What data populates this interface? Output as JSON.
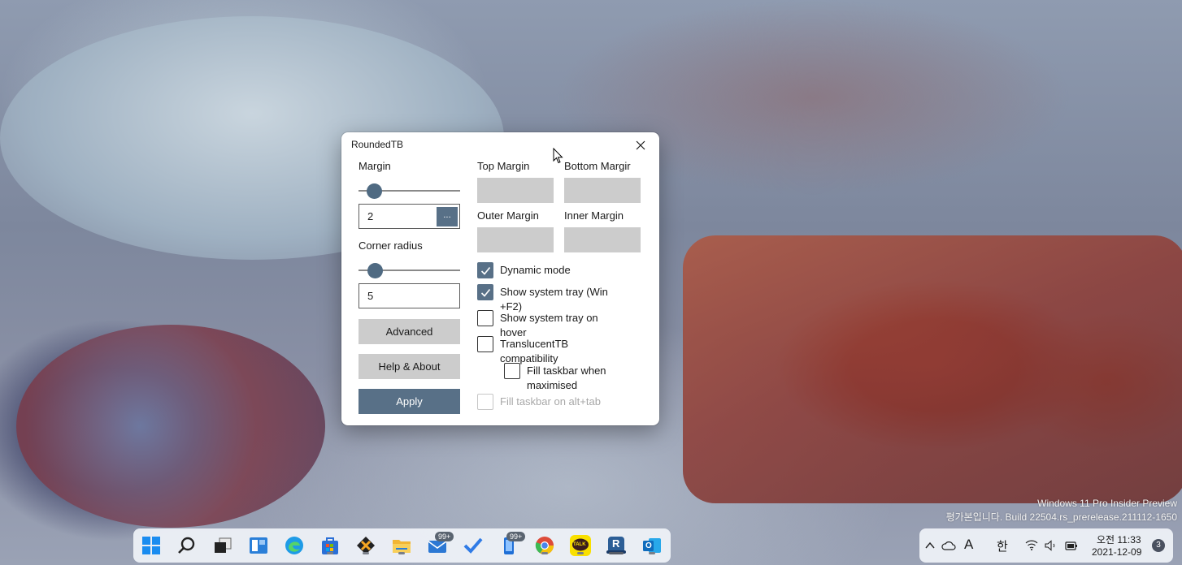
{
  "window": {
    "title": "RoundedTB",
    "left": {
      "margin_label": "Margin",
      "margin_slider_value": 2,
      "margin_value": "2",
      "margin_dots": "...",
      "corner_radius_label": "Corner radius",
      "corner_radius_slider_value": 5,
      "corner_radius_value": "5",
      "advanced": "Advanced",
      "help_about": "Help & About",
      "apply": "Apply"
    },
    "right": {
      "top_margin": "Top Margin",
      "bottom_margin": "Bottom Margir",
      "outer_margin": "Outer Margin",
      "inner_margin": "Inner Margin",
      "checkboxes": [
        {
          "label": "Dynamic mode",
          "checked": true,
          "enabled": true
        },
        {
          "label": "Show system tray (Win\n+F2)",
          "checked": true,
          "enabled": true
        },
        {
          "label": "Show system tray on\nhover",
          "checked": false,
          "enabled": true
        },
        {
          "label": "TranslucentTB\ncompatibility",
          "checked": false,
          "enabled": true
        },
        {
          "label": "Fill taskbar when\nmaximised",
          "checked": false,
          "enabled": true
        },
        {
          "label": "Fill taskbar on alt+tab",
          "checked": false,
          "enabled": false
        }
      ]
    }
  },
  "watermark": {
    "line1": "Windows 11 Pro Insider Preview",
    "line2": "평가본입니다. Build 22504.rs_prerelease.211112-1650"
  },
  "taskbar": {
    "icons": [
      {
        "name": "start-icon",
        "color": "#1a8cf0"
      },
      {
        "name": "search-icon",
        "color": "#222222"
      },
      {
        "name": "task-view-icon",
        "color": "#222222"
      },
      {
        "name": "widgets-icon",
        "color": "#2a7fd8"
      },
      {
        "name": "edge-icon",
        "color": "#1e9be6"
      },
      {
        "name": "store-icon",
        "color": "#2b6fd6"
      },
      {
        "name": "xbox-game-icon",
        "color": "#222222"
      },
      {
        "name": "file-explorer-icon",
        "color": "#f2b634"
      },
      {
        "name": "mail-icon",
        "color": "#2c78d4",
        "badge": "99+"
      },
      {
        "name": "todo-icon",
        "color": "#2f7be6"
      },
      {
        "name": "phone-icon",
        "color": "#1f6fd6",
        "badge": "99+"
      },
      {
        "name": "chrome-icon",
        "color": "#dd4b39"
      },
      {
        "name": "kakaotalk-icon",
        "color": "#f9e000",
        "text": "TALK"
      },
      {
        "name": "roundedtb-icon",
        "color": "#2c5e96",
        "text": "R"
      },
      {
        "name": "outlook-icon",
        "color": "#0f6cbd",
        "text": "O"
      }
    ],
    "tray": {
      "ime_a": "A",
      "ime_han": "한",
      "time": "오전 11:33",
      "date": "2021-12-09",
      "notification_count": "3"
    }
  }
}
